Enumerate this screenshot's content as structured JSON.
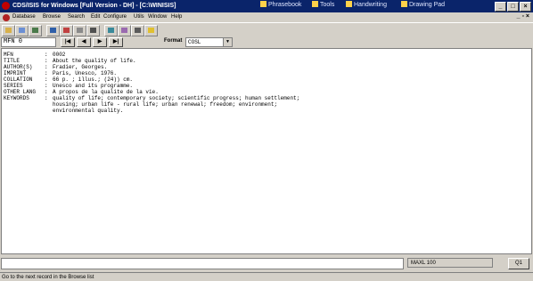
{
  "window": {
    "title": "CDS/ISIS for Windows [Full Version - DH] - [C:\\WINISIS]",
    "taskbar": [
      {
        "label": "Phrasebook"
      },
      {
        "label": "Tools"
      },
      {
        "label": "Handwriting"
      },
      {
        "label": "Drawing Pad"
      }
    ],
    "controls": [
      "_",
      "□",
      "×"
    ]
  },
  "menubar": {
    "items": [
      "Database",
      "Browse",
      "Search",
      "Edit",
      "Configure",
      "Utils",
      "Window",
      "Help"
    ],
    "mdi_controls": "_ ▫ ×"
  },
  "navbar": {
    "mfn_value": "MFN 0",
    "buttons": [
      "|◀",
      "◀",
      "▶",
      "▶|"
    ],
    "format_label": "Format",
    "format_value": "COSL"
  },
  "record": [
    {
      "field": "MFN",
      "value": "0002"
    },
    {
      "field": "TITLE",
      "value": "About the quality of life."
    },
    {
      "field": "AUTHOR(S)",
      "value": "Fradier, Georges."
    },
    {
      "field": "IMPRINT",
      "value": "Paris, Unesco, 1976."
    },
    {
      "field": "COLLATION",
      "value": "66 p. ; illus.; (24)) cm."
    },
    {
      "field": "SERIES",
      "value": "Unesco and its programme."
    },
    {
      "field": "OTHER LANG",
      "value": "A propos de la qualite de la vie."
    },
    {
      "field": "KEYWORDS",
      "value": "quality of life; contemporary society; scientific progress; human settlement;"
    },
    {
      "field": "",
      "value": "housing; urban life - rural life; urban renewal; freedom; environment;"
    },
    {
      "field": "",
      "value": "environmental quality."
    }
  ],
  "status": {
    "max_label": "MAXL 100",
    "q_button": "Q1"
  },
  "hint": "Go to the next record in the Browse list"
}
